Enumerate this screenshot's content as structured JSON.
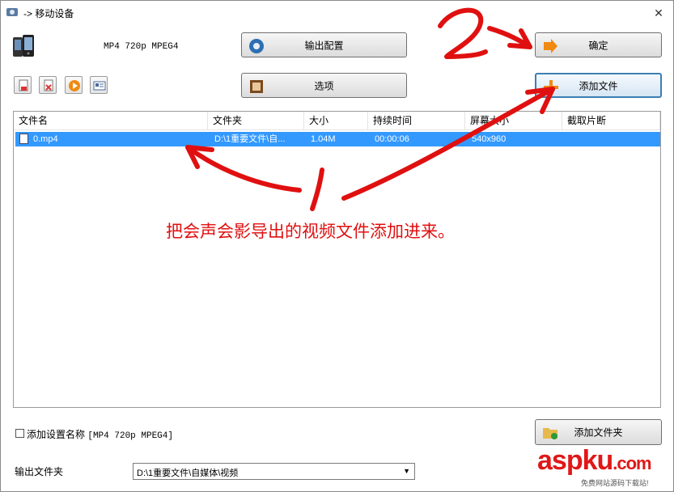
{
  "window": {
    "title": "-> 移动设备",
    "close_glyph": "✕"
  },
  "preset": {
    "name": "MP4 720p MPEG4"
  },
  "buttons": {
    "output_config": "输出配置",
    "options": "选项",
    "ok": "确定",
    "add_file": "添加文件",
    "add_folder": "添加文件夹"
  },
  "table": {
    "columns": [
      "文件名",
      "文件夹",
      "大小",
      "持续时间",
      "屏幕大小",
      "截取片断"
    ],
    "rows": [
      {
        "name": "0.mp4",
        "folder": "D:\\1重要文件\\自...",
        "size": "1.04M",
        "duration": "00:00:06",
        "screen": "540x960",
        "clip": ""
      }
    ]
  },
  "add_setting_name": {
    "label": "添加设置名称",
    "value": "[MP4 720p MPEG4]",
    "checked": false
  },
  "output_folder": {
    "label": "输出文件夹",
    "value": "D:\\1重要文件\\自媒体\\视频"
  },
  "annotation": {
    "text": "把会声会影导出的视频文件添加进来。",
    "marks": [
      "1",
      "2"
    ],
    "color": "#e01010"
  },
  "watermark": {
    "brand": "aspku",
    "suffix": ".com",
    "tagline": "免费网站源码下载站!"
  }
}
